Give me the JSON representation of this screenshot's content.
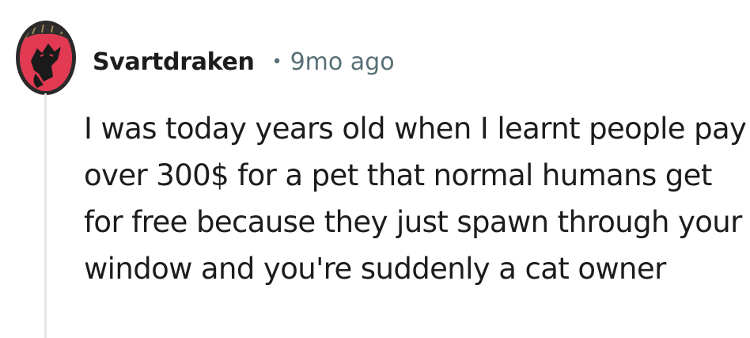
{
  "comment": {
    "avatar_icon": "dragon-avatar-icon",
    "username": "Svartdraken",
    "separator": "•",
    "timestamp": "9mo ago",
    "body": "I was today years old when I learnt people pay over 300$ for a pet that normal humans get for free because they just spawn through your window and you're suddenly a cat owner"
  },
  "colors": {
    "avatar_bg": "#e23a52",
    "username": "#1c1c1c",
    "timestamp": "#576f76",
    "thread_line": "#e2e5e7"
  }
}
